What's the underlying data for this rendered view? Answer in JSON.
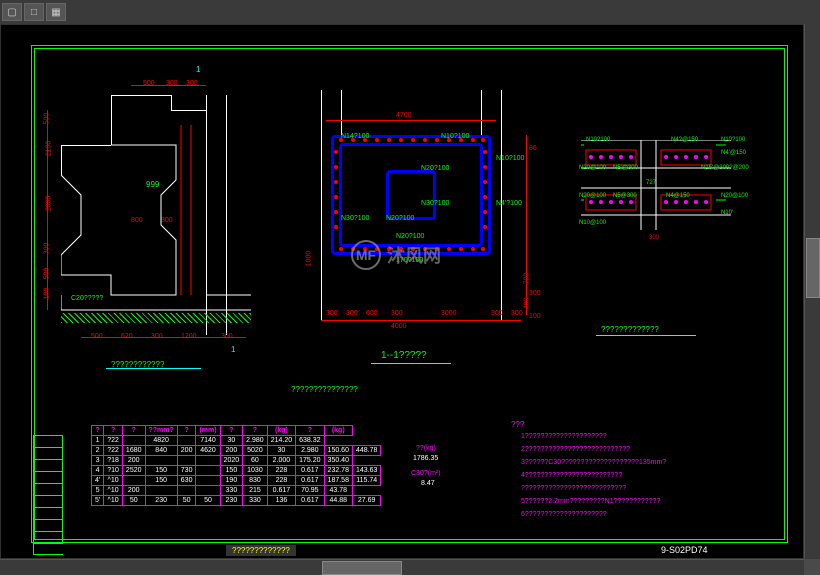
{
  "toolbar": {
    "btn1": "▢",
    "btn2": "□",
    "btn3": "▦"
  },
  "drawing": {
    "left_section": {
      "dims": {
        "d1": "500",
        "d2": "300",
        "d3": "300",
        "d4": "500",
        "d5": "2100",
        "d6": "2000",
        "d7": "300",
        "d8": "500",
        "d9": "100",
        "d10": "800",
        "d11": "800",
        "d12": "500",
        "d13": "620",
        "d14": "300",
        "d15": "1200",
        "d16": "300",
        "d17": "999"
      },
      "label": "C20?????",
      "marker": "1",
      "title": "????????????"
    },
    "mid_section": {
      "dims": {
        "top": "4700",
        "d1": "N14?100",
        "d2": "N10?100",
        "d3": "N20?100",
        "d4": "N30?100",
        "d5": "N20?100",
        "d6": "N30?100",
        "d7": "N20?100",
        "d8": "170?100",
        "d9": "N4'?100",
        "d10": "N10?100",
        "b1": "300",
        "b2": "300",
        "b3": "600",
        "b4": "300",
        "b5": "4000",
        "b6": "3000",
        "b7": "300",
        "b8": "300",
        "b9": "1000",
        "v1": "86",
        "v2": "700",
        "v3": "300",
        "v4": "400",
        "v5": "100"
      },
      "title": "1--1?????"
    },
    "right_section": {
      "labels": {
        "l1": "N10?100",
        "l2": "N4?@150",
        "l3": "N10?100",
        "l4": "N4'@150",
        "l5": "N20@100",
        "l6": "N5'@300",
        "l7": "N15'@300?@200",
        "l8": "N20@100",
        "l9": "N5@300",
        "l10": "N4@150",
        "l11": "N20@100",
        "l12": "N10@100",
        "l13": "727",
        "l14": "300",
        "l15": "N10'"
      },
      "title": "?????????????"
    },
    "notes_title": "???????????????",
    "table": {
      "headers": [
        "?",
        "?",
        "?",
        "   ??mm?",
        "?",
        "(mm)",
        "?",
        "?",
        "(kg)",
        "?",
        "(kg)"
      ],
      "rows": [
        [
          "1",
          "?22",
          "",
          "4820",
          "",
          "7140",
          "30",
          "2.980",
          "214.20",
          "638.32"
        ],
        [
          "2",
          "?22",
          "1680",
          "840",
          "200",
          "4620",
          "200",
          "5020",
          "30",
          "2.980",
          "150.60",
          "448.78"
        ],
        [
          "3",
          "?18",
          "200",
          "",
          "",
          "",
          "2020",
          "60",
          "2.000",
          "175.20",
          "350.40"
        ],
        [
          "4",
          "?10",
          "2520",
          "150",
          "730",
          "",
          "150",
          "1030",
          "228",
          "0.617",
          "232.78",
          "143.63"
        ],
        [
          "4'",
          "^10",
          "",
          "150",
          "630",
          "",
          "190",
          "830",
          "228",
          "0.617",
          "187.58",
          "115.74"
        ],
        [
          "5",
          "^10",
          "200",
          "",
          "",
          "",
          "330",
          "215",
          "0.617",
          "70.95",
          "43.78"
        ],
        [
          "5'",
          "^10",
          "50",
          "230",
          "50",
          "50",
          "230",
          "330",
          "136",
          "0.617",
          "44.88",
          "27.69"
        ]
      ],
      "side_labels": {
        "l1": "??(kg)",
        "l2": "1786.35",
        "l3": "C30?(m²)",
        "l4": "8.47"
      }
    },
    "notes": {
      "title": "???",
      "lines": [
        "1?????????????????????",
        "2???????????????????????????",
        "3??????C30????????????????????135mm?",
        "4?????????????????????????",
        "???????????????????????????",
        "5??????2.2mm?????????N1????????????",
        "6?????????????????????"
      ]
    },
    "bottom_title": "?????????????",
    "drawing_number": "9-S02PD74"
  },
  "watermark": "沐风网"
}
